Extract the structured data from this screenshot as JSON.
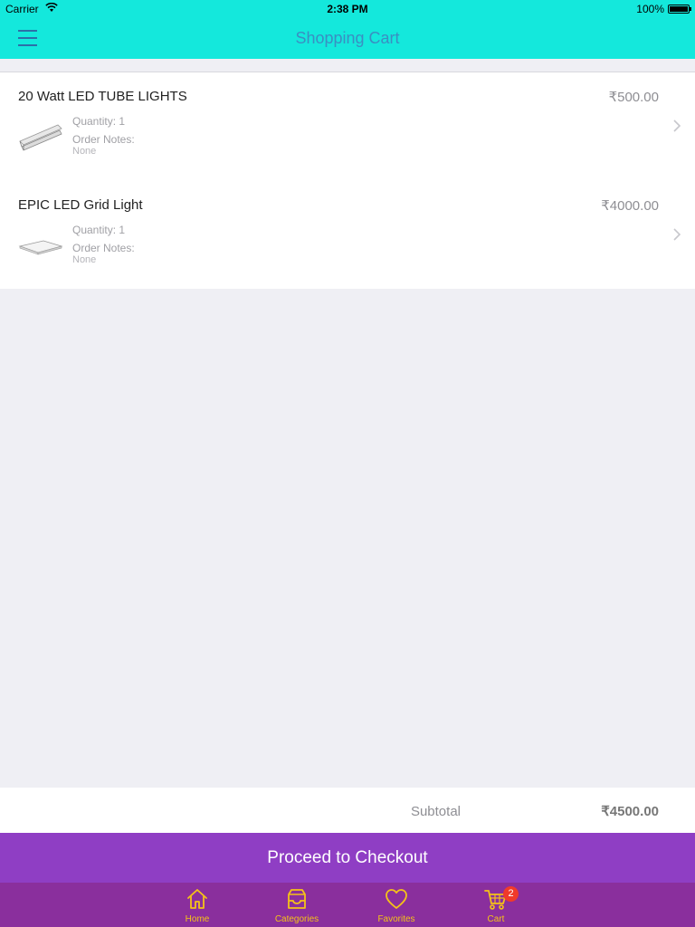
{
  "status_bar": {
    "carrier": "Carrier",
    "time": "2:38 PM",
    "battery": "100%"
  },
  "nav": {
    "title": "Shopping Cart",
    "menu_icon": "hamburger-menu-icon"
  },
  "cart_items": [
    {
      "name": "20 Watt LED TUBE LIGHTS",
      "price": "₹500.00",
      "quantity": "Quantity: 1",
      "notes_label": "Order Notes:",
      "notes_value": "None"
    },
    {
      "name": "EPIC LED Grid Light",
      "price": "₹4000.00",
      "quantity": "Quantity: 1",
      "notes_label": "Order Notes:",
      "notes_value": "None"
    }
  ],
  "subtotal": {
    "label": "Subtotal",
    "value": "₹4500.00"
  },
  "checkout": {
    "label": "Proceed to Checkout"
  },
  "tabs": [
    {
      "label": "Home",
      "icon": "home-icon"
    },
    {
      "label": "Categories",
      "icon": "inbox-tray-icon"
    },
    {
      "label": "Favorites",
      "icon": "heart-icon"
    },
    {
      "label": "Cart",
      "icon": "cart-icon",
      "badge": "2"
    }
  ],
  "colors": {
    "nav_bg": "#14e8dc",
    "nav_title": "#3a8fc2",
    "checkout_bg": "#8f3ec4",
    "tab_bar_bg": "#8a2f9d",
    "tab_accent": "#f5c218",
    "badge": "#f03a2a"
  }
}
